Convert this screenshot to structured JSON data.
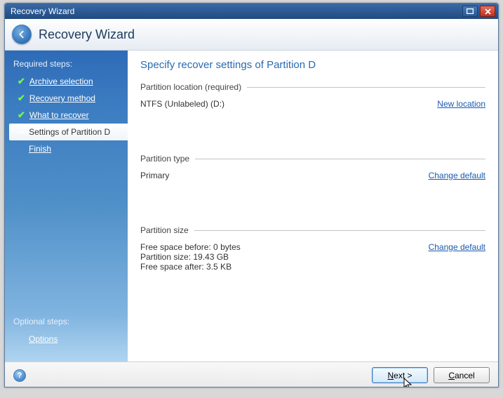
{
  "titlebar": {
    "title": "Recovery Wizard"
  },
  "header": {
    "title": "Recovery Wizard"
  },
  "sidebar": {
    "required_label": "Required steps:",
    "steps": [
      {
        "label": "Archive selection"
      },
      {
        "label": "Recovery method"
      },
      {
        "label": "What to recover"
      },
      {
        "label": "Settings of Partition D"
      },
      {
        "label": "Finish"
      }
    ],
    "optional_label": "Optional steps:",
    "optional_steps": [
      {
        "label": "Options"
      }
    ]
  },
  "main": {
    "heading": "Specify recover settings of Partition D",
    "groups": {
      "location": {
        "label": "Partition location (required)",
        "value": "NTFS (Unlabeled) (D:)",
        "link": "New location"
      },
      "type": {
        "label": "Partition type",
        "value": "Primary",
        "link": "Change default"
      },
      "size": {
        "label": "Partition size",
        "free_before": "Free space before: 0 bytes",
        "part_size": "Partition size: 19.43 GB",
        "free_after": "Free space after: 3.5 KB",
        "link": "Change default"
      }
    }
  },
  "footer": {
    "next": "Next >",
    "cancel": "Cancel"
  }
}
